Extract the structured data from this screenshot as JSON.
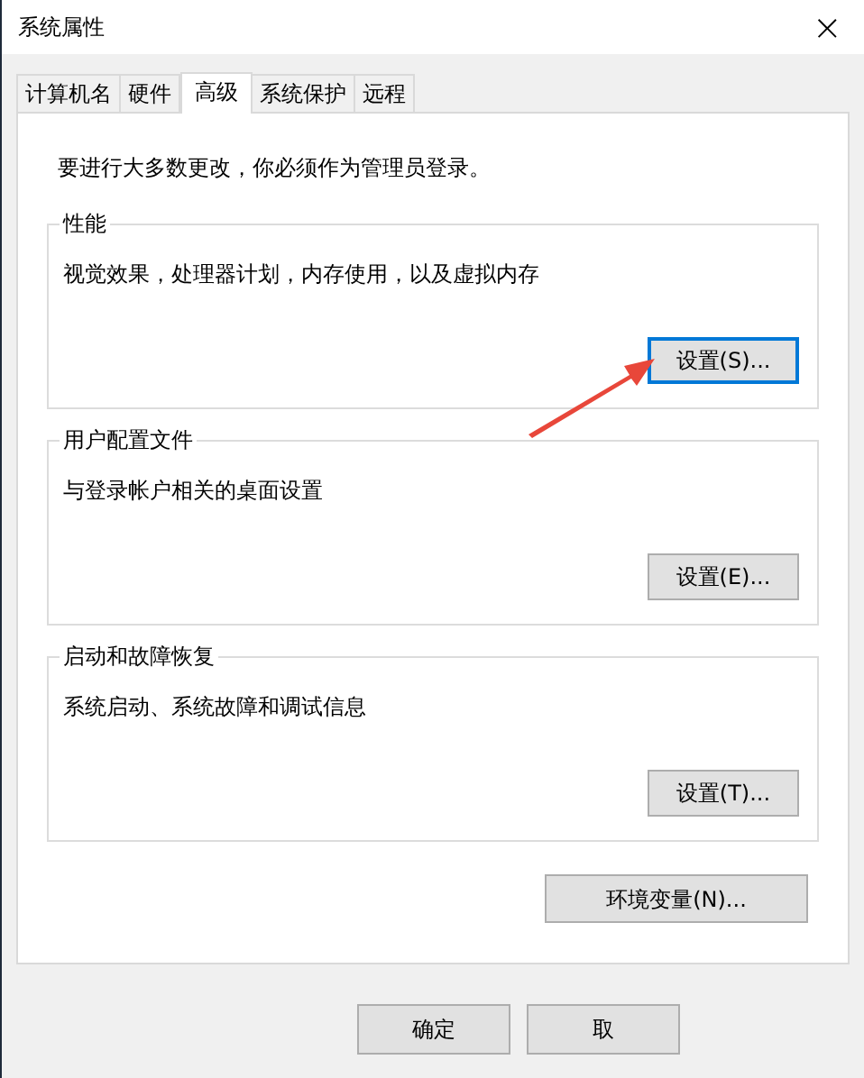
{
  "window": {
    "title": "系统属性",
    "close": "×"
  },
  "tabs": [
    {
      "label": "计算机名",
      "selected": false
    },
    {
      "label": "硬件",
      "selected": false
    },
    {
      "label": "高级",
      "selected": true
    },
    {
      "label": "系统保护",
      "selected": false
    },
    {
      "label": "远程",
      "selected": false
    }
  ],
  "notice": "要进行大多数更改，你必须作为管理员登录。",
  "groups": [
    {
      "title": "性能",
      "description": "视觉效果，处理器计划，内存使用，以及虚拟内存",
      "button": "设置(S)...",
      "focused": true
    },
    {
      "title": "用户配置文件",
      "description": "与登录帐户相关的桌面设置",
      "button": "设置(E)...",
      "focused": false
    },
    {
      "title": "启动和故障恢复",
      "description": "系统启动、系统故障和调试信息",
      "button": "设置(T)...",
      "focused": false
    }
  ],
  "env_button": "环境变量(N)...",
  "footer_buttons": [
    "确定",
    "取"
  ]
}
